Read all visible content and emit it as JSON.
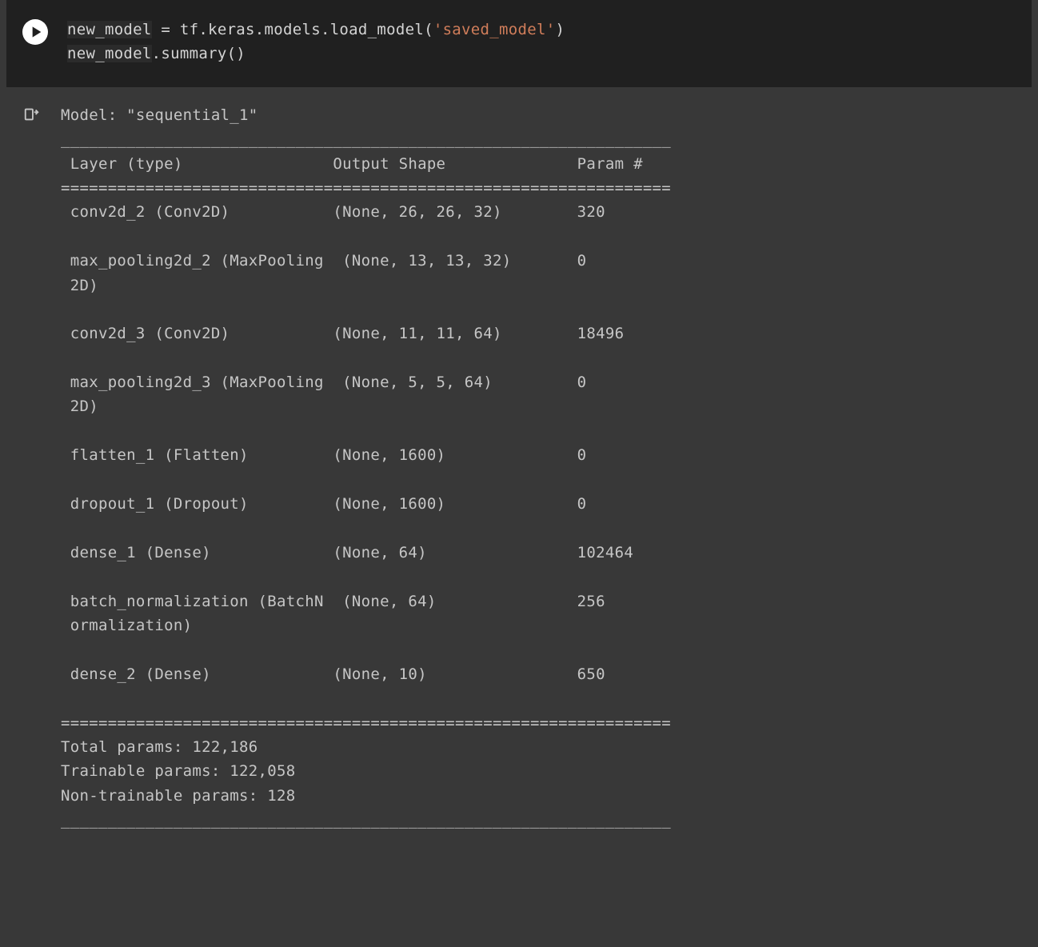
{
  "code": {
    "line1_var": "new_model",
    "line1_rest": " = tf.keras.models.load_model(",
    "line1_str": "'saved_model'",
    "line1_end": ")",
    "line2_var": "new_model",
    "line2_rest": ".summary()"
  },
  "output": {
    "model_line": "Model: \"sequential_1\"",
    "top_rule": "_________________________________________________________________",
    "header": " Layer (type)                Output Shape              Param #   ",
    "header_rule": "=================================================================",
    "rows": [
      " conv2d_2 (Conv2D)           (None, 26, 26, 32)        320       ",
      "                                                                 ",
      " max_pooling2d_2 (MaxPooling  (None, 13, 13, 32)       0         ",
      " 2D)                                                             ",
      "                                                                 ",
      " conv2d_3 (Conv2D)           (None, 11, 11, 64)        18496     ",
      "                                                                 ",
      " max_pooling2d_3 (MaxPooling  (None, 5, 5, 64)         0         ",
      " 2D)                                                             ",
      "                                                                 ",
      " flatten_1 (Flatten)         (None, 1600)              0         ",
      "                                                                 ",
      " dropout_1 (Dropout)         (None, 1600)              0         ",
      "                                                                 ",
      " dense_1 (Dense)             (None, 64)                102464    ",
      "                                                                 ",
      " batch_normalization (BatchN  (None, 64)               256       ",
      " ormalization)                                                   ",
      "                                                                 ",
      " dense_2 (Dense)             (None, 10)                650       ",
      "                                                                 "
    ],
    "footer_rule": "=================================================================",
    "total_params": "Total params: 122,186",
    "trainable_params": "Trainable params: 122,058",
    "non_trainable_params": "Non-trainable params: 128",
    "bottom_rule": "_________________________________________________________________"
  },
  "chart_data": {
    "type": "table",
    "title": "Model: sequential_1",
    "columns": [
      "Layer (type)",
      "Output Shape",
      "Param #"
    ],
    "rows": [
      [
        "conv2d_2 (Conv2D)",
        "(None, 26, 26, 32)",
        320
      ],
      [
        "max_pooling2d_2 (MaxPooling2D)",
        "(None, 13, 13, 32)",
        0
      ],
      [
        "conv2d_3 (Conv2D)",
        "(None, 11, 11, 64)",
        18496
      ],
      [
        "max_pooling2d_3 (MaxPooling2D)",
        "(None, 5, 5, 64)",
        0
      ],
      [
        "flatten_1 (Flatten)",
        "(None, 1600)",
        0
      ],
      [
        "dropout_1 (Dropout)",
        "(None, 1600)",
        0
      ],
      [
        "dense_1 (Dense)",
        "(None, 64)",
        102464
      ],
      [
        "batch_normalization (BatchNormalization)",
        "(None, 64)",
        256
      ],
      [
        "dense_2 (Dense)",
        "(None, 10)",
        650
      ]
    ],
    "summary": {
      "total_params": 122186,
      "trainable_params": 122058,
      "non_trainable_params": 128
    }
  }
}
